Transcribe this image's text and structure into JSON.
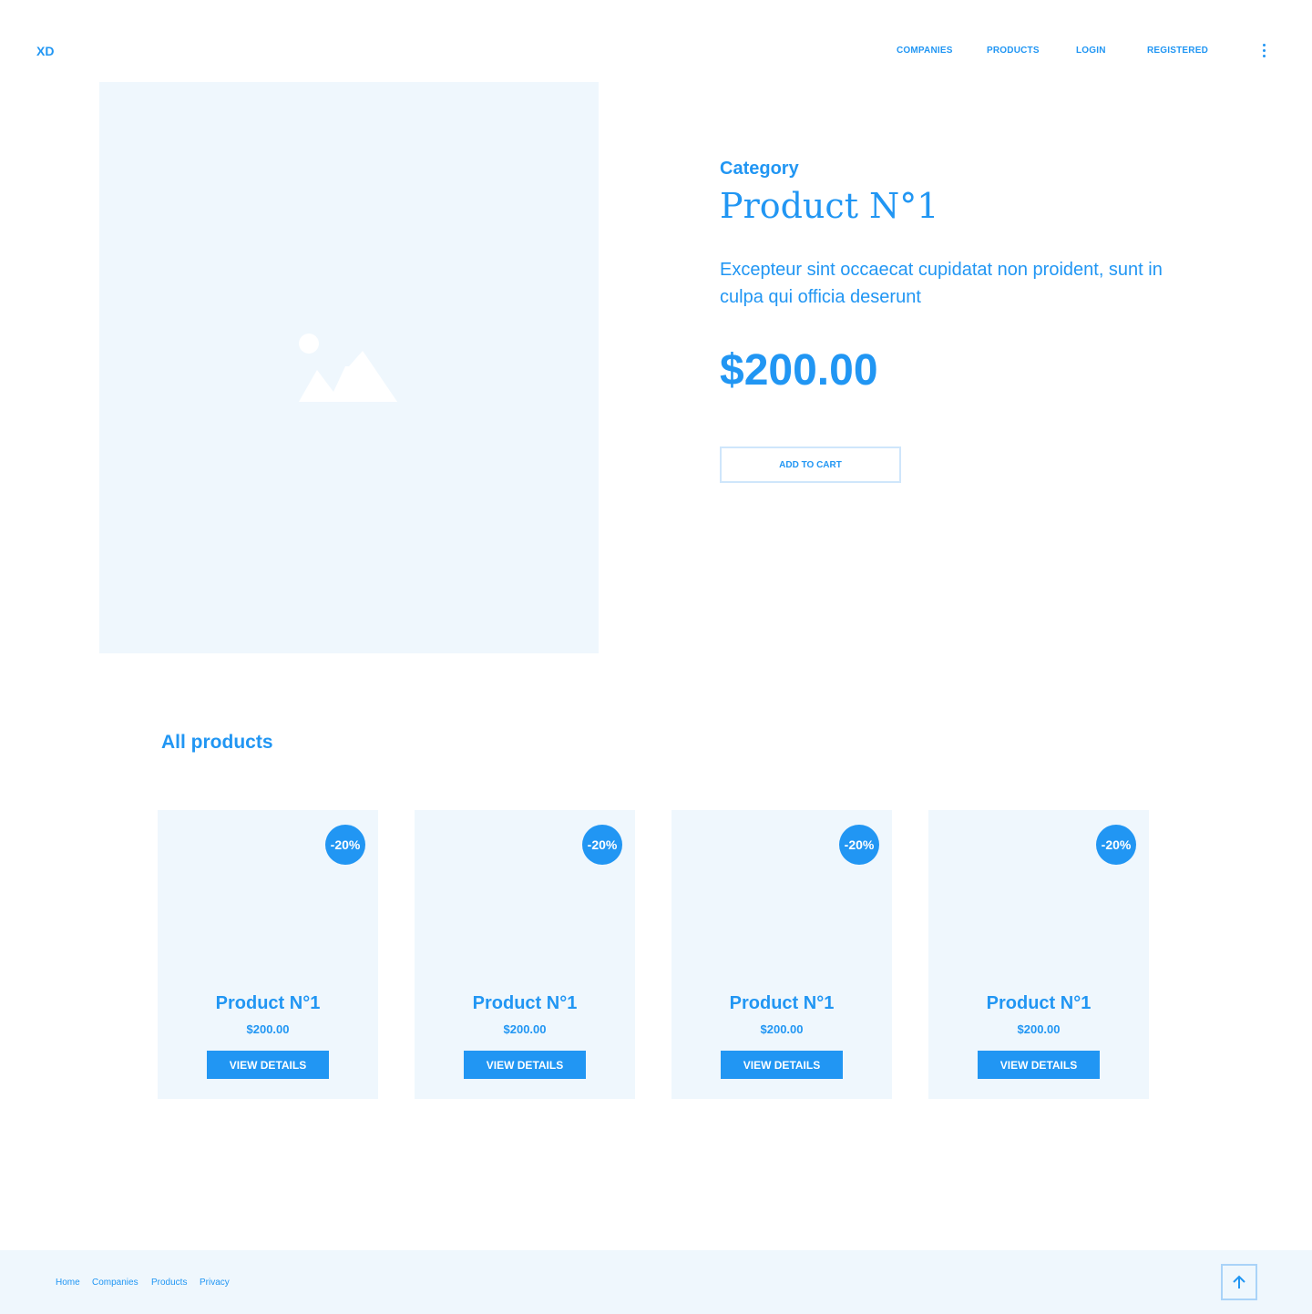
{
  "header": {
    "logo": "XD",
    "nav": [
      "COMPANIES",
      "PRODUCTS",
      "LOGIN",
      "REGISTERED"
    ],
    "menu_icon": "more-vertical-icon"
  },
  "product": {
    "image_icon": "image-placeholder-icon",
    "category": "Category",
    "title": "Product N°1",
    "description": "Excepteur sint occaecat cupidatat non proident, sunt in culpa qui officia deserunt",
    "price": "$200.00",
    "add_to_cart": "ADD TO CART"
  },
  "all_products": {
    "title": "All products",
    "items": [
      {
        "badge": "-20%",
        "name": "Product N°1",
        "price": "$200.00",
        "button": "VIEW DETAILS"
      },
      {
        "badge": "-20%",
        "name": "Product N°1",
        "price": "$200.00",
        "button": "VIEW DETAILS"
      },
      {
        "badge": "-20%",
        "name": "Product N°1",
        "price": "$200.00",
        "button": "VIEW DETAILS"
      },
      {
        "badge": "-20%",
        "name": "Product N°1",
        "price": "$200.00",
        "button": "VIEW DETAILS"
      }
    ]
  },
  "footer": {
    "links": [
      "Home",
      "Companies",
      "Products",
      "Privacy"
    ],
    "back_to_top_icon": "arrow-up-icon"
  },
  "colors": {
    "accent": "#2196f3",
    "panel": "#eff7fd",
    "background": "#ffffff"
  }
}
